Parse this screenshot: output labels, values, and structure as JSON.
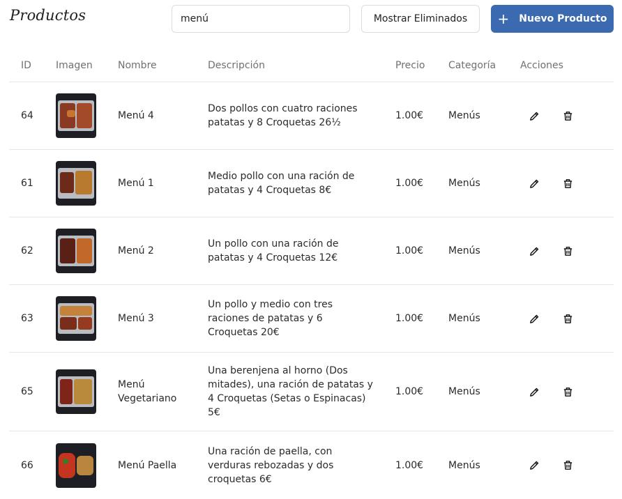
{
  "page": {
    "title": "Productos"
  },
  "search": {
    "value": "menú",
    "placeholder": ""
  },
  "buttons": {
    "show_deleted": "Mostrar Eliminados",
    "new_product": "Nuevo Producto"
  },
  "table": {
    "headers": {
      "id": "ID",
      "image": "Imagen",
      "name": "Nombre",
      "description": "Descripción",
      "price": "Precio",
      "category": "Categoría",
      "actions": "Acciones"
    },
    "rows": [
      {
        "id": "64",
        "name": "Menú 4",
        "description": "Dos pollos con cuatro raciones patatas y 8 Croquetas 26½",
        "price": "1.00€",
        "category": "Menús"
      },
      {
        "id": "61",
        "name": "Menú 1",
        "description": "Medio pollo con una ración de patatas y 4 Croquetas 8€",
        "price": "1.00€",
        "category": "Menús"
      },
      {
        "id": "62",
        "name": "Menú 2",
        "description": "Un pollo con una ración de patatas y 4 Croquetas 12€",
        "price": "1.00€",
        "category": "Menús"
      },
      {
        "id": "63",
        "name": "Menú 3",
        "description": "Un pollo y medio con tres raciones de patatas y 6 Croquetas 20€",
        "price": "1.00€",
        "category": "Menús"
      },
      {
        "id": "65",
        "name": "Menú Vegetariano",
        "description": "Una berenjena al horno (Dos mitades), una ración de patatas y 4 Croquetas (Setas o Espinacas) 5€",
        "price": "1.00€",
        "category": "Menús"
      },
      {
        "id": "66",
        "name": "Menú Paella",
        "description": "Una ración de paella, con verduras rebozadas y dos croquetas 6€",
        "price": "1.00€",
        "category": "Menús"
      }
    ]
  },
  "icons": {
    "add": "plus-icon",
    "edit": "pencil-icon",
    "delete": "trash-icon"
  },
  "colors": {
    "primary": "#3b6ab1",
    "border": "#e6e6e6",
    "header_text": "#707070"
  }
}
